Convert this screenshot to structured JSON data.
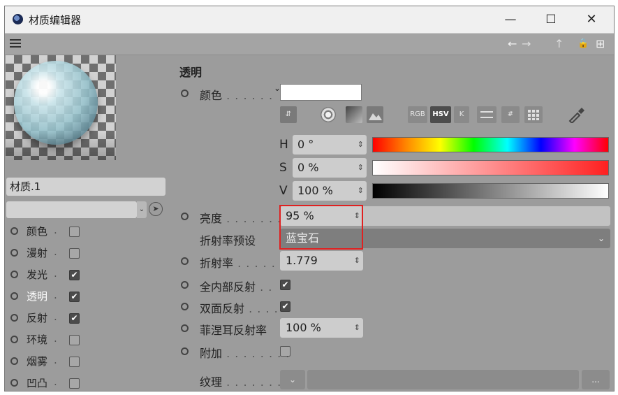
{
  "window": {
    "title": "材质编辑器",
    "min_glyph": "—",
    "max_glyph": "☐",
    "close_glyph": "✕"
  },
  "toolbar": {
    "back": "←",
    "forward": "→",
    "up": "↑",
    "lock": "🔒",
    "new": "⊞"
  },
  "material": {
    "name": "材质.1"
  },
  "channels": [
    {
      "label": "颜色",
      "checked": false
    },
    {
      "label": "漫射",
      "checked": false
    },
    {
      "label": "发光",
      "checked": true
    },
    {
      "label": "透明",
      "checked": true,
      "active": true
    },
    {
      "label": "反射",
      "checked": true
    },
    {
      "label": "环境",
      "checked": false
    },
    {
      "label": "烟雾",
      "checked": false
    },
    {
      "label": "凹凸",
      "checked": false
    }
  ],
  "panel": {
    "section_title": "透明",
    "color_label": "颜色",
    "picker_tools": {
      "rgb": "RGB",
      "hsv": "HSV",
      "k": "K",
      "hash": "#"
    },
    "h": {
      "letter": "H",
      "value": "0 °"
    },
    "s": {
      "letter": "S",
      "value": "0 %"
    },
    "v": {
      "letter": "V",
      "value": "100 %"
    },
    "brightness": {
      "label": "亮度",
      "value": "95 %"
    },
    "ior_preset": {
      "label": "折射率预设",
      "value": "蓝宝石"
    },
    "ior": {
      "label": "折射率",
      "value": "1.779"
    },
    "total_internal_reflection": {
      "label": "全内部反射",
      "checked": true
    },
    "double_sided_reflection": {
      "label": "双面反射",
      "checked": true
    },
    "fresnel": {
      "label": "菲涅耳反射率",
      "value": "100 %"
    },
    "additive": {
      "label": "附加",
      "checked": false
    },
    "texture": {
      "label": "纹理",
      "more": "..."
    }
  },
  "colors": {
    "highlight": "#e02020",
    "active_channel": "#ffffff"
  }
}
